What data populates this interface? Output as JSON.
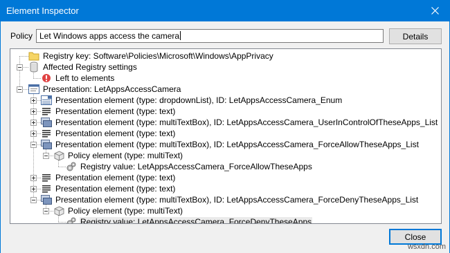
{
  "window": {
    "title": "Element Inspector"
  },
  "policy": {
    "label": "Policy",
    "value": "Let Windows apps access the camera"
  },
  "buttons": {
    "details": "Details",
    "close": "Close"
  },
  "tree": {
    "rows": [
      {
        "text": "Registry key: Software\\Policies\\Microsoft\\Windows\\AppPrivacy",
        "icon": "folder-icon",
        "level": 0
      },
      {
        "text": "Affected Registry settings",
        "icon": "registry-cylinder-icon",
        "level": 0,
        "expanded": true
      },
      {
        "text": "Left to elements",
        "icon": "error-icon",
        "level": 1
      },
      {
        "text": "Presentation: LetAppsAccessCamera",
        "icon": "presentation-window-icon",
        "level": 0,
        "expanded": true
      },
      {
        "text": "Presentation element (type: dropdownList), ID: LetAppsAccessCamera_Enum",
        "icon": "dropdown-list-icon",
        "level": 1,
        "expanded": false
      },
      {
        "text": "Presentation element (type: text)",
        "icon": "text-lines-icon",
        "level": 1,
        "expanded": false
      },
      {
        "text": "Presentation element (type: multiTextBox), ID: LetAppsAccessCamera_UserInControlOfTheseApps_List",
        "icon": "multitextbox-icon",
        "level": 1,
        "expanded": false
      },
      {
        "text": "Presentation element (type: text)",
        "icon": "text-lines-icon",
        "level": 1,
        "expanded": false
      },
      {
        "text": "Presentation element (type: multiTextBox), ID: LetAppsAccessCamera_ForceAllowTheseApps_List",
        "icon": "multitextbox-icon",
        "level": 1,
        "expanded": true
      },
      {
        "text": "Policy element (type: multiText)",
        "icon": "policy-cube-icon",
        "level": 2,
        "expanded": true
      },
      {
        "text": "Registry value: LetAppsAccessCamera_ForceAllowTheseApps",
        "icon": "registry-gear-icon",
        "level": 3
      },
      {
        "text": "Presentation element (type: text)",
        "icon": "text-lines-icon",
        "level": 1,
        "expanded": false
      },
      {
        "text": "Presentation element (type: text)",
        "icon": "text-lines-icon",
        "level": 1,
        "expanded": false
      },
      {
        "text": "Presentation element (type: multiTextBox), ID: LetAppsAccessCamera_ForceDenyTheseApps_List",
        "icon": "multitextbox-icon",
        "level": 1,
        "expanded": true
      },
      {
        "text": "Policy element (type: multiText)",
        "icon": "policy-cube-icon",
        "level": 2,
        "expanded": true
      },
      {
        "text": "Registry value: LetAppsAccessCamera_ForceDenyTheseApps",
        "icon": "registry-gear-icon",
        "level": 3,
        "selected": true
      }
    ]
  },
  "watermark": "wsxdn.com",
  "colors": {
    "titlebar": "#0078d7",
    "window_bg": "#f0f0f0",
    "selection": "#eaeaea"
  }
}
